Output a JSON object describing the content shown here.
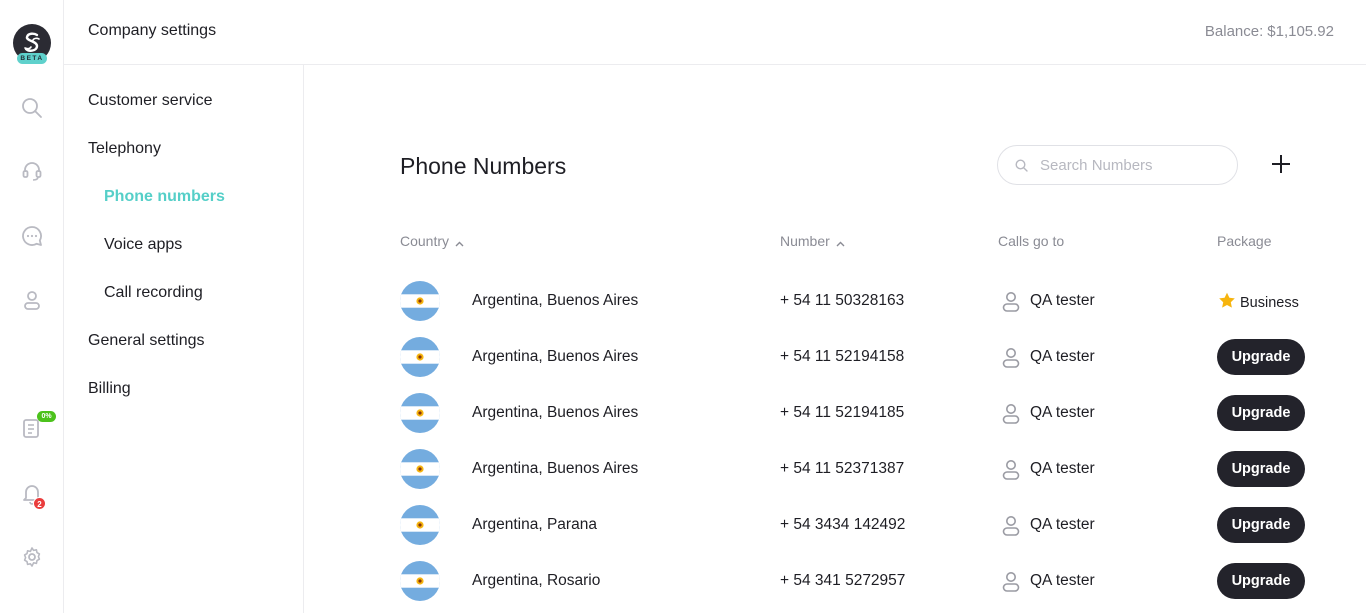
{
  "app": {
    "logo_icon": "app-logo-icon",
    "beta_label": "BETA",
    "rail_icons": [
      "search-icon",
      "headset-icon",
      "chat-icon",
      "user-icon",
      "checklist-icon",
      "bell-icon",
      "gear-icon"
    ],
    "checklist_badge": "0%",
    "notifications_badge": "2"
  },
  "header": {
    "title": "Company settings",
    "balance_label": "Balance:",
    "balance_value": "$1,105.92"
  },
  "nav": {
    "customer_service": "Customer service",
    "telephony": "Telephony",
    "phone_numbers": "Phone numbers",
    "voice_apps": "Voice apps",
    "call_recording": "Call recording",
    "general_settings": "General settings",
    "billing": "Billing"
  },
  "main": {
    "title": "Phone Numbers",
    "search_placeholder": "Search Numbers",
    "add_icon": "plus-icon",
    "columns": {
      "country": "Country",
      "number": "Number",
      "calls_go_to": "Calls go to",
      "package": "Package"
    },
    "rows": [
      {
        "country": "Argentina, Buenos Aires",
        "number": "+ 54 11 50328163",
        "calls_go_to": "QA tester",
        "package": "Business"
      },
      {
        "country": "Argentina, Buenos Aires",
        "number": "+ 54 11 52194158",
        "calls_go_to": "QA tester",
        "package": "Upgrade"
      },
      {
        "country": "Argentina, Buenos Aires",
        "number": "+ 54 11 52194185",
        "calls_go_to": "QA tester",
        "package": "Upgrade"
      },
      {
        "country": "Argentina, Buenos Aires",
        "number": "+ 54 11 52371387",
        "calls_go_to": "QA tester",
        "package": "Upgrade"
      },
      {
        "country": "Argentina, Parana",
        "number": "+ 54 3434 142492",
        "calls_go_to": "QA tester",
        "package": "Upgrade"
      },
      {
        "country": "Argentina, Rosario",
        "number": "+ 54 341 5272957",
        "calls_go_to": "QA tester",
        "package": "Upgrade"
      }
    ]
  },
  "colors": {
    "accent": "#55cfc8",
    "button_dark": "#23232b",
    "muted_text": "#8a8b94",
    "flag_blue": "#74acdf",
    "flag_sun": "#f6b40e"
  }
}
